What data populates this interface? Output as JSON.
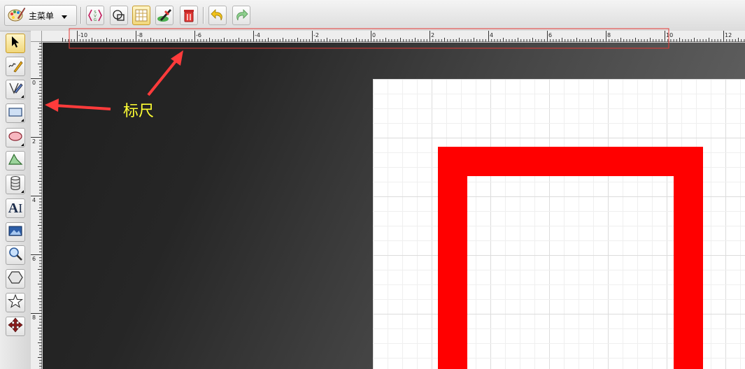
{
  "toolbar": {
    "main_menu_label": "主菜单",
    "buttons": [
      {
        "name": "svg-source-button",
        "icon": "svg-source-icon",
        "text": "SVG"
      },
      {
        "name": "wireframe-button",
        "icon": "wireframe-icon"
      },
      {
        "name": "grid-toggle-button",
        "icon": "grid-icon",
        "active": true
      },
      {
        "name": "canvas-background-button",
        "icon": "paint-brush-icon"
      },
      {
        "name": "clear-button",
        "icon": "trash-icon"
      },
      {
        "name": "undo-button",
        "icon": "undo-icon"
      },
      {
        "name": "redo-button",
        "icon": "redo-icon"
      }
    ]
  },
  "tools": [
    {
      "name": "select-tool",
      "icon": "cursor-arrow-icon",
      "active": true
    },
    {
      "name": "freehand-tool",
      "icon": "pencil-icon"
    },
    {
      "name": "path-tool",
      "icon": "pen-icon"
    },
    {
      "name": "rectangle-tool",
      "icon": "rectangle-icon"
    },
    {
      "name": "ellipse-tool",
      "icon": "ellipse-icon"
    },
    {
      "name": "shape-tool",
      "icon": "triangle-icon"
    },
    {
      "name": "cylinder-tool",
      "icon": "cylinder-icon"
    },
    {
      "name": "text-tool",
      "icon": "text-icon",
      "text": "A"
    },
    {
      "name": "image-tool",
      "icon": "image-icon"
    },
    {
      "name": "zoom-tool",
      "icon": "magnifier-icon"
    },
    {
      "name": "polygon-tool",
      "icon": "hexagon-icon"
    },
    {
      "name": "star-tool",
      "icon": "star-icon"
    },
    {
      "name": "move-tool",
      "icon": "move-arrows-icon"
    }
  ],
  "ruler": {
    "horizontal_labels": [
      "-10",
      "-8",
      "-6",
      "-4",
      "-2",
      "0",
      "2",
      "4",
      "6",
      "8",
      "10",
      "12"
    ],
    "vertical_labels": [
      "0",
      "2",
      "4",
      "6",
      "8"
    ]
  },
  "annotation": {
    "label": "标尺",
    "color": "#ffff33",
    "arrow_color": "#ff3b3b",
    "highlight_color": "#e53935"
  },
  "colors": {
    "shape_stroke": "#ff0000",
    "active_tool": "#f1d77a"
  }
}
